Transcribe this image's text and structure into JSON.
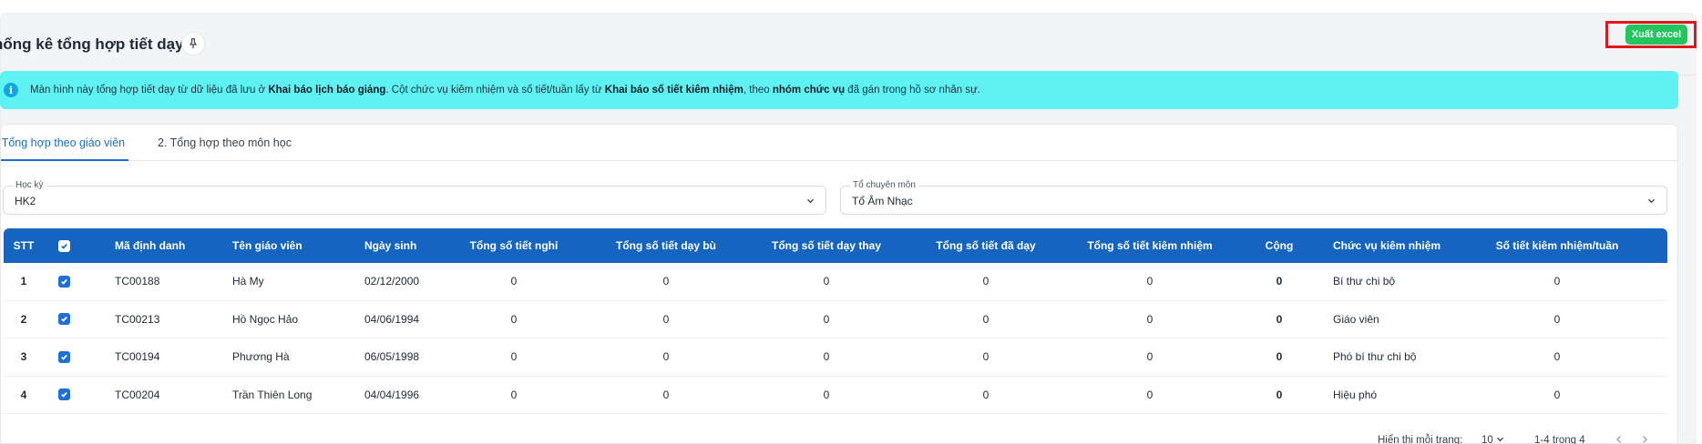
{
  "header": {
    "title": "hống kê tổng hợp tiết dạy",
    "export_label": "Xuất excel"
  },
  "info": {
    "p1": "Màn hình này tổng hợp tiết dạy từ dữ liệu đã lưu ở ",
    "b1": "Khai báo lịch báo giảng",
    "p2": ". Cột chức vụ kiêm nhiệm và số tiết/tuần lấy từ ",
    "b2": "Khai báo số tiết kiêm nhiệm",
    "p3": ", theo ",
    "b3": "nhóm chức vụ",
    "p4": " đã gán trong hồ sơ nhân sự."
  },
  "tabs": [
    {
      "label": ". Tổng hợp theo giáo viên",
      "active": true
    },
    {
      "label": "2. Tổng hợp theo môn học",
      "active": false
    }
  ],
  "filters": {
    "semester": {
      "label": "Học kỳ",
      "value": "HK2"
    },
    "department": {
      "label": "Tổ chuyên môn",
      "value": "Tổ Âm Nhạc"
    }
  },
  "table": {
    "columns": [
      "STT",
      "",
      "Mã định danh",
      "Tên giáo viên",
      "Ngày sinh",
      "Tổng số tiết nghỉ",
      "Tổng số tiết dạy bù",
      "Tổng số tiết dạy thay",
      "Tổng số tiết đã dạy",
      "Tổng số tiết kiêm nhiệm",
      "Cộng",
      "Chức vụ kiêm nhiệm",
      "Số tiết kiêm nhiệm/tuần"
    ],
    "rows": [
      [
        "1",
        "",
        "TC00188",
        "Hà My",
        "02/12/2000",
        "0",
        "0",
        "0",
        "0",
        "0",
        "0",
        "Bí thư chi bộ",
        "0"
      ],
      [
        "2",
        "",
        "TC00213",
        "Hồ Ngọc Hảo",
        "04/06/1994",
        "0",
        "0",
        "0",
        "0",
        "0",
        "0",
        "Giáo viên",
        "0"
      ],
      [
        "3",
        "",
        "TC00194",
        "Phương Hà",
        "06/05/1998",
        "0",
        "0",
        "0",
        "0",
        "0",
        "0",
        "Phó bí thư chi bộ",
        "0"
      ],
      [
        "4",
        "",
        "TC00204",
        "Trần Thiên Long",
        "04/04/1996",
        "0",
        "0",
        "0",
        "0",
        "0",
        "0",
        "Hiệu phó",
        "0"
      ]
    ]
  },
  "pagination": {
    "per_page_label": "Hiển thị mỗi trang:",
    "per_page": "10",
    "range": "1-4 trong 4"
  },
  "colors": {
    "primary": "#1565c0",
    "export": "#22c55e",
    "info_bg": "#5ef2f2",
    "highlight": "#e0161b"
  }
}
